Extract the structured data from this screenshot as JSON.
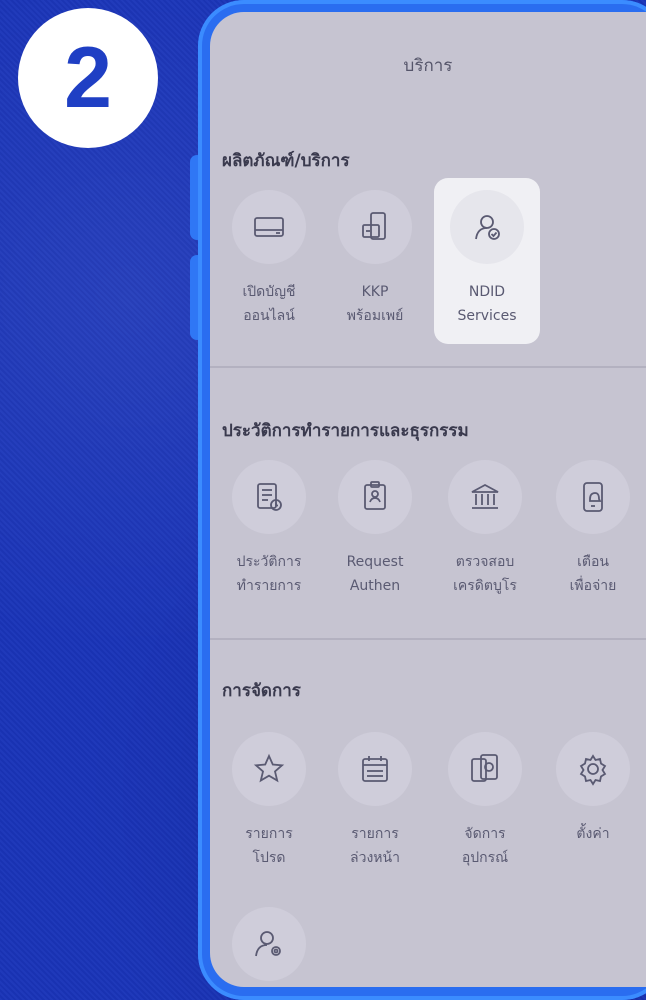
{
  "step_number": "2",
  "header": {
    "title": "บริการ"
  },
  "sections": [
    {
      "title": "ผลิตภัณฑ์/บริการ",
      "items": [
        {
          "icon": "card-icon",
          "line1": "เปิดบัญชี",
          "line2": "ออนไลน์"
        },
        {
          "icon": "phone-card-icon",
          "line1": "KKP",
          "line2": "พร้อมเพย์"
        },
        {
          "icon": "user-check-icon",
          "line1": "NDID",
          "line2": "Services",
          "highlighted": true
        }
      ]
    },
    {
      "title": "ประวัติการทำรายการและธุรกรรม",
      "items": [
        {
          "icon": "history-doc-icon",
          "line1": "ประวัติการ",
          "line2": "ทำรายการ"
        },
        {
          "icon": "id-badge-icon",
          "line1": "Request",
          "line2": "Authen"
        },
        {
          "icon": "bank-icon",
          "line1": "ตรวจสอบ",
          "line2": "เครดิตบูโร"
        },
        {
          "icon": "phone-bell-icon",
          "line1": "เตือน",
          "line2": "เพื่อจ่าย"
        }
      ]
    },
    {
      "title": "การจัดการ",
      "items": [
        {
          "icon": "star-icon",
          "line1": "รายการ",
          "line2": "โปรด"
        },
        {
          "icon": "calendar-icon",
          "line1": "รายการ",
          "line2": "ล่วงหน้า"
        },
        {
          "icon": "device-settings-icon",
          "line1": "จัดการ",
          "line2": "อุปกรณ์"
        },
        {
          "icon": "gear-icon",
          "line1": "ตั้งค่า",
          "line2": ""
        },
        {
          "icon": "user-gear-icon",
          "line1": "",
          "line2": ""
        }
      ]
    }
  ],
  "colors": {
    "background": "#1a34b8",
    "phone_frame": "#2a6df0",
    "screen": "#c6c4d1",
    "highlight": "#f0f0f4",
    "badge_text": "#1f3fc4"
  }
}
